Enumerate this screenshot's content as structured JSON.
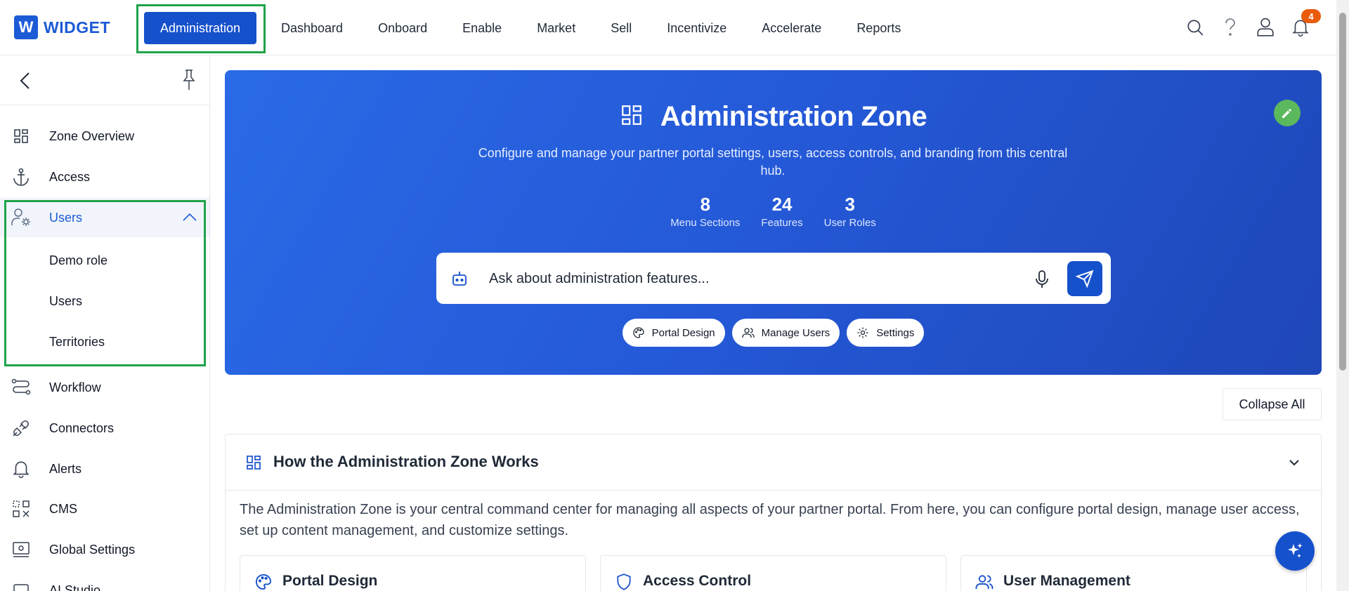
{
  "brand": {
    "logo_letter": "W",
    "name": "WIDGET"
  },
  "nav": {
    "items": [
      "Administration",
      "Dashboard",
      "Onboard",
      "Enable",
      "Market",
      "Sell",
      "Incentivize",
      "Accelerate",
      "Reports"
    ],
    "active": "Administration"
  },
  "header_icons": {
    "search": "search-icon",
    "help": "help-icon",
    "user": "user-icon",
    "bell": "bell-icon",
    "notification_count": "4"
  },
  "sidebar": {
    "items": [
      {
        "label": "Zone Overview",
        "icon": "grid-icon"
      },
      {
        "label": "Access",
        "icon": "anchor-icon"
      },
      {
        "label": "Users",
        "icon": "user-gear-icon",
        "expanded": true
      },
      {
        "label": "Workflow",
        "icon": "workflow-icon"
      },
      {
        "label": "Connectors",
        "icon": "plug-icon"
      },
      {
        "label": "Alerts",
        "icon": "bell-icon"
      },
      {
        "label": "CMS",
        "icon": "cms-icon"
      },
      {
        "label": "Global Settings",
        "icon": "settings-icon"
      },
      {
        "label": "AI Studio",
        "icon": "ai-icon"
      }
    ],
    "users_sub": [
      "Demo role",
      "Users",
      "Territories"
    ]
  },
  "hero": {
    "title": "Administration Zone",
    "subtitle": "Configure and manage your partner portal settings, users, access controls, and branding from this central hub.",
    "stats": [
      {
        "value": "8",
        "label": "Menu Sections"
      },
      {
        "value": "24",
        "label": "Features"
      },
      {
        "value": "3",
        "label": "User Roles"
      }
    ],
    "ask_placeholder": "Ask about administration features...",
    "chips": [
      {
        "label": "Portal Design",
        "icon": "palette-icon"
      },
      {
        "label": "Manage Users",
        "icon": "users-icon"
      },
      {
        "label": "Settings",
        "icon": "gear-icon"
      }
    ]
  },
  "collapse_all": "Collapse All",
  "section": {
    "title": "How the Administration Zone Works",
    "body": "The Administration Zone is your central command center for managing all aspects of your partner portal. From here, you can configure portal design, manage user access, set up content management, and customize settings.",
    "cards": [
      {
        "title": "Portal Design",
        "icon": "palette-icon"
      },
      {
        "title": "Access Control",
        "icon": "shield-icon"
      },
      {
        "title": "User Management",
        "icon": "users-icon"
      }
    ]
  },
  "colors": {
    "primary": "#1651cc",
    "highlight": "#1fa34a",
    "badge": "#ea5b0c",
    "edit": "#5cb85c"
  }
}
